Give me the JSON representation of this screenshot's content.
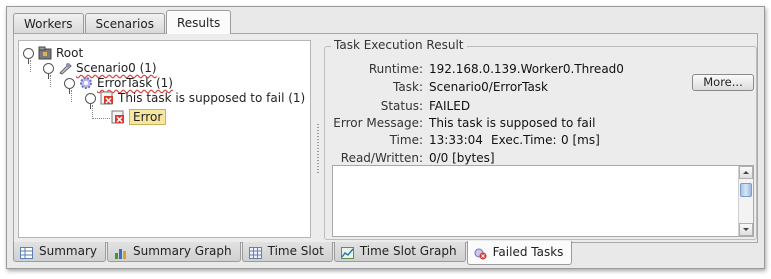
{
  "top_tabs": [
    "Workers",
    "Scenarios",
    "Results"
  ],
  "tree": {
    "root": "Root",
    "scenario": "Scenario0 (1)",
    "task": "ErrorTask (1)",
    "failure": "This task is supposed to fail (1)",
    "error": "Error"
  },
  "result": {
    "title": "Task Execution Result",
    "runtime_label": "Runtime:",
    "runtime_value": "192.168.0.139.Worker0.Thread0",
    "task_label": "Task:",
    "task_value": "Scenario0/ErrorTask",
    "more_button": "More...",
    "status_label": "Status:",
    "status_value": "FAILED",
    "error_label": "Error Message:",
    "error_value": "This task is supposed to fail",
    "time_label": "Time:",
    "time_value": "13:33:04",
    "exec_label": "Exec.Time:",
    "exec_value": "0 [ms]",
    "rw_label": "Read/Written:",
    "rw_value": "0/0 [bytes]"
  },
  "bottom_tabs": [
    "Summary",
    "Summary Graph",
    "Time Slot",
    "Time Slot Graph",
    "Failed Tasks"
  ],
  "colors": {
    "highlight": "#f7e6a0",
    "error_icon": "#d63a2f",
    "gear": "#7b7bd1"
  }
}
